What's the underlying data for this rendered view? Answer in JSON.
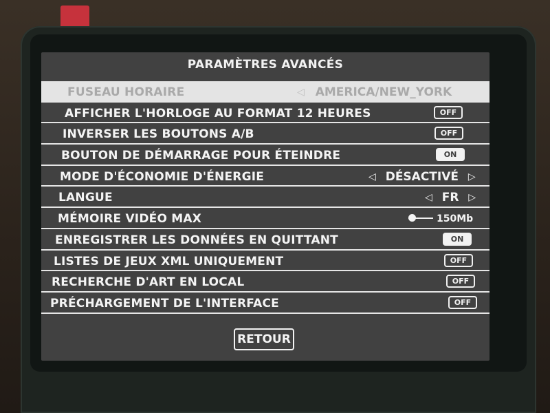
{
  "screen": {
    "title": "PARAMÈTRES AVANCÉS"
  },
  "settings": [
    {
      "label": "FUSEAU HORAIRE",
      "type": "selector",
      "value": "AMERICA/NEW_YORK",
      "selected": true
    },
    {
      "label": "AFFICHER L'HORLOGE AU FORMAT 12 HEURES",
      "type": "toggle",
      "value": "OFF"
    },
    {
      "label": "INVERSER LES BOUTONS A/B",
      "type": "toggle",
      "value": "OFF"
    },
    {
      "label": "BOUTON DE DÉMARRAGE POUR ÉTEINDRE",
      "type": "toggle",
      "value": "ON"
    },
    {
      "label": "MODE D'ÉCONOMIE D'ÉNERGIE",
      "type": "selector",
      "value": "DÉSACTIVÉ"
    },
    {
      "label": "LANGUE",
      "type": "selector",
      "value": "FR"
    },
    {
      "label": "MÉMOIRE VIDÉO MAX",
      "type": "slider",
      "value": "150Mb",
      "slider_level": 0
    },
    {
      "label": "ENREGISTRER LES DONNÉES EN QUITTANT",
      "type": "toggle",
      "value": "ON"
    },
    {
      "label": "LISTES DE JEUX XML UNIQUEMENT",
      "type": "toggle",
      "value": "OFF"
    },
    {
      "label": "RECHERCHE D'ART EN LOCAL",
      "type": "toggle",
      "value": "OFF"
    },
    {
      "label": "PRÉCHARGEMENT DE L'INTERFACE",
      "type": "toggle",
      "value": "OFF"
    }
  ],
  "footer": {
    "back_label": "RETOUR"
  },
  "icons": {
    "arrow_left": "◁",
    "arrow_right": "▷"
  },
  "colors": {
    "screen_background": "#414141",
    "text": "#f4f4f4",
    "selected_row": "#e4e4e4",
    "selected_text": "#a9a9a9",
    "sticker": "#c6323c"
  }
}
